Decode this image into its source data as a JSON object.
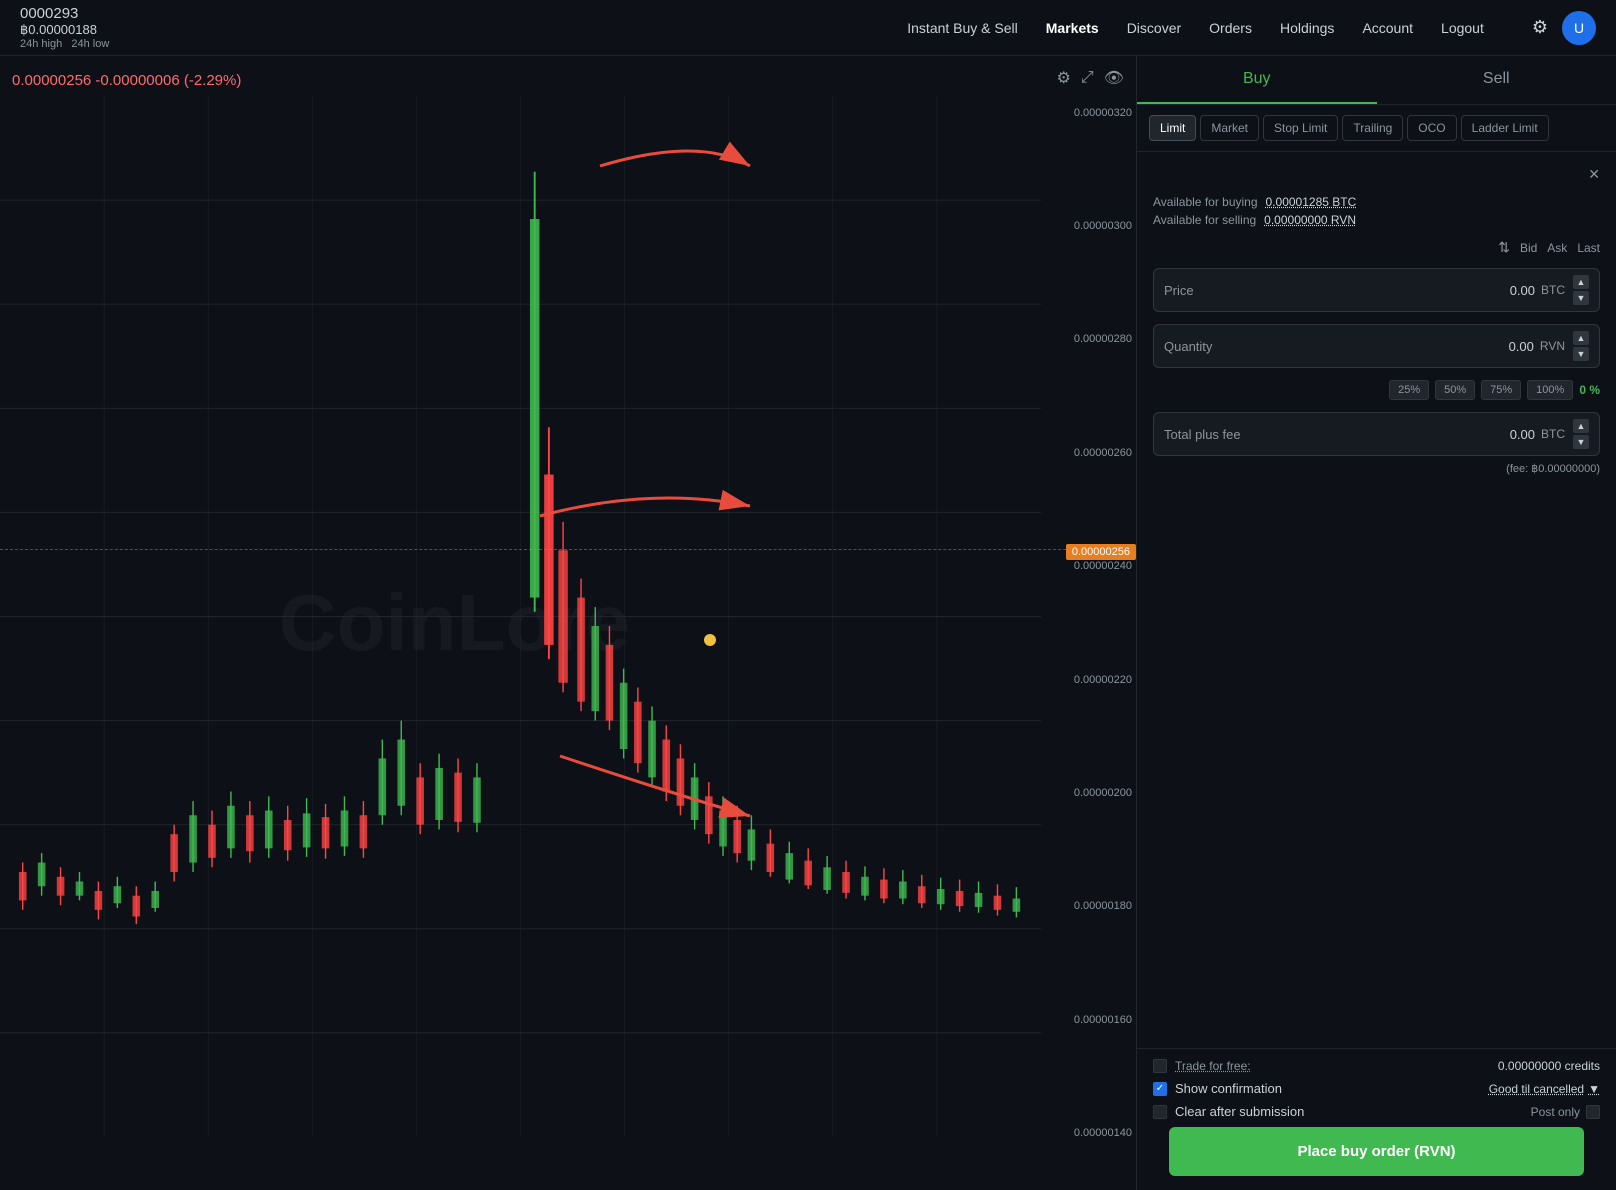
{
  "nav": {
    "ticker": "0000293",
    "price": "฿0.00000188",
    "price_label": "24h high",
    "price_sub": "24h low",
    "links": [
      {
        "label": "Instant Buy & Sell",
        "active": false
      },
      {
        "label": "Markets",
        "active": true
      },
      {
        "label": "Discover",
        "active": false
      },
      {
        "label": "Orders",
        "active": false
      },
      {
        "label": "Holdings",
        "active": false
      },
      {
        "label": "Account",
        "active": false
      },
      {
        "label": "Logout",
        "active": false
      }
    ]
  },
  "chart": {
    "price_change": "0.00000256  -0.00000006 (-2.29%)",
    "current_price_tag": "0.00000256",
    "yaxis_labels": [
      "0.00000320",
      "0.00000300",
      "0.00000280",
      "0.00000260",
      "0.00000240",
      "0.00000220",
      "0.00000200",
      "0.00000180",
      "0.00000160",
      "0.00000140"
    ]
  },
  "orderform": {
    "buy_label": "Buy",
    "sell_label": "Sell",
    "order_types": [
      "Limit",
      "Market",
      "Stop Limit",
      "Trailing",
      "OCO",
      "Ladder Limit"
    ],
    "available_for_buying_label": "Available for buying",
    "available_for_buying_value": "0.00001285 BTC",
    "available_for_selling_label": "Available for selling",
    "available_for_selling_value": "0.00000000 RVN",
    "bid_label": "Bid",
    "ask_label": "Ask",
    "last_label": "Last",
    "price_label": "Price",
    "price_value": "0.00",
    "price_unit": "BTC",
    "quantity_label": "Quantity",
    "quantity_value": "0.00",
    "quantity_unit": "RVN",
    "pct_options": [
      "25%",
      "50%",
      "75%",
      "100%"
    ],
    "pct_current": "0 %",
    "total_label": "Total plus fee",
    "total_value": "0.00",
    "total_unit": "BTC",
    "fee_note": "(fee: ฿0.00000000)",
    "trade_for_free_label": "Trade for free:",
    "trade_for_free_value": "0.00000000 credits",
    "show_confirmation_label": "Show confirmation",
    "show_confirmation_checked": true,
    "gtc_label": "Good til cancelled",
    "clear_after_submission_label": "Clear after submission",
    "clear_after_submission_checked": false,
    "post_only_label": "Post only",
    "post_only_checked": false,
    "place_order_label": "Place buy order (RVN)"
  },
  "annotations": [
    {
      "type": "arrow",
      "from": "buy-tab",
      "label": "arrow1"
    },
    {
      "type": "arrow",
      "from": "quantity-field",
      "label": "arrow2"
    },
    {
      "type": "arrow",
      "from": "place-order-btn",
      "label": "arrow3"
    }
  ]
}
